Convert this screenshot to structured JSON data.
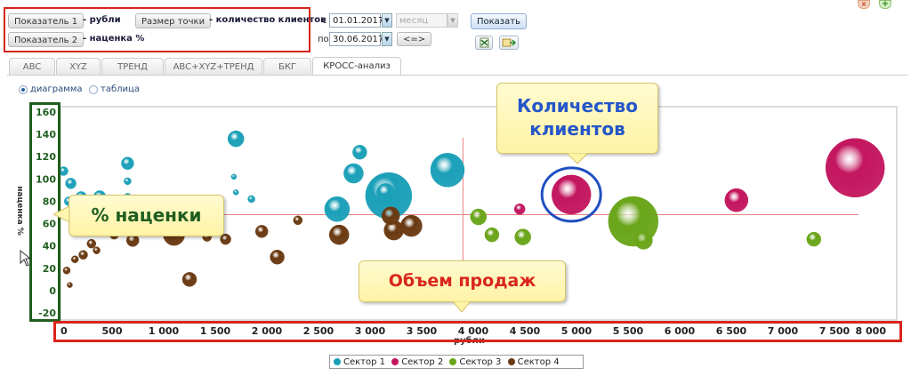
{
  "toolbar": {
    "indicator1_button": "Показатель 1",
    "indicator1_value": "- рубли",
    "indicator2_button": "Показатель 2",
    "indicator2_value": "- наценка %",
    "point_size_button": "Размер точки",
    "point_size_value": "- количество клиентов",
    "from_label": "с",
    "to_label": "по",
    "date_from": "01.01.2017",
    "date_to": "30.06.2017",
    "period_select": "месяц",
    "swap_button": "<=>",
    "show_button": "Показать"
  },
  "tabs": [
    {
      "label": "ABC"
    },
    {
      "label": "XYZ"
    },
    {
      "label": "ТРЕНД"
    },
    {
      "label": "ABC+XYZ+ТРЕНД"
    },
    {
      "label": "БКГ"
    },
    {
      "label": "КРОСС-анализ",
      "active": true
    }
  ],
  "view_mode": {
    "diagram": "диаграмма",
    "table": "таблица",
    "selected": "diagram"
  },
  "callouts": {
    "markup": "% наценки",
    "sales_volume": "Объем продаж",
    "client_count_line1": "Количество",
    "client_count_line2": "клиентов"
  },
  "colors": {
    "highlight_red": "#d9251c",
    "highlight_green": "#1f5e1f",
    "highlight_blue": "#1f4fc0",
    "callout_text_red": "#d9251c",
    "callout_text_green": "#1f5e1f",
    "callout_text_blue": "#2456c9"
  },
  "chart_data": {
    "type": "scatter",
    "subtype": "bubble",
    "xlabel": "рубли",
    "ylabel": "наценка %",
    "xlim": [
      0,
      8000
    ],
    "ylim": [
      -20,
      160
    ],
    "x_ticks": [
      "0",
      "500",
      "1 000",
      "1 500",
      "2 000",
      "2 500",
      "3 000",
      "3 500",
      "4 000",
      "4 500",
      "5 000",
      "5 500",
      "6 000",
      "6 500",
      "7 000",
      "7 500",
      "8 000"
    ],
    "y_ticks": [
      "160",
      "140",
      "120",
      "100",
      "80",
      "60",
      "40",
      "20",
      "0",
      "-20"
    ],
    "reference_lines": {
      "x": 3900,
      "y": 68
    },
    "grid": false,
    "legend_position": "bottom",
    "series": [
      {
        "name": "Сектор 1",
        "color": "#1ba0b8",
        "points": [
          {
            "x": 30,
            "y": 107,
            "size": 5
          },
          {
            "x": 100,
            "y": 96,
            "size": 6
          },
          {
            "x": 80,
            "y": 80,
            "size": 5
          },
          {
            "x": 200,
            "y": 84,
            "size": 6
          },
          {
            "x": 380,
            "y": 84,
            "size": 7
          },
          {
            "x": 650,
            "y": 114,
            "size": 7
          },
          {
            "x": 650,
            "y": 98,
            "size": 4
          },
          {
            "x": 650,
            "y": 84,
            "size": 4
          },
          {
            "x": 1700,
            "y": 136,
            "size": 9
          },
          {
            "x": 1680,
            "y": 102,
            "size": 3
          },
          {
            "x": 1850,
            "y": 82,
            "size": 4
          },
          {
            "x": 1700,
            "y": 88,
            "size": 3
          },
          {
            "x": 2680,
            "y": 73,
            "size": 14
          },
          {
            "x": 2840,
            "y": 105,
            "size": 11
          },
          {
            "x": 2900,
            "y": 124,
            "size": 8
          },
          {
            "x": 3180,
            "y": 85,
            "size": 26
          },
          {
            "x": 3150,
            "y": 88,
            "size": 10
          },
          {
            "x": 3750,
            "y": 108,
            "size": 19
          }
        ]
      },
      {
        "name": "Сектор 2",
        "color": "#c3165f",
        "points": [
          {
            "x": 4450,
            "y": 73,
            "size": 6
          },
          {
            "x": 4950,
            "y": 86,
            "size": 22
          },
          {
            "x": 6550,
            "y": 81,
            "size": 13
          },
          {
            "x": 7700,
            "y": 110,
            "size": 33
          }
        ]
      },
      {
        "name": "Сектор 3",
        "color": "#6aa51a",
        "points": [
          {
            "x": 4050,
            "y": 66,
            "size": 9
          },
          {
            "x": 4180,
            "y": 50,
            "size": 8
          },
          {
            "x": 4480,
            "y": 48,
            "size": 9
          },
          {
            "x": 5550,
            "y": 62,
            "size": 28
          },
          {
            "x": 5650,
            "y": 45,
            "size": 10
          },
          {
            "x": 7300,
            "y": 46,
            "size": 8
          }
        ]
      },
      {
        "name": "Сектор 4",
        "color": "#6a3a12",
        "points": [
          {
            "x": 60,
            "y": 18,
            "size": 4
          },
          {
            "x": 90,
            "y": 5,
            "size": 3
          },
          {
            "x": 140,
            "y": 28,
            "size": 4
          },
          {
            "x": 220,
            "y": 32,
            "size": 5
          },
          {
            "x": 300,
            "y": 42,
            "size": 5
          },
          {
            "x": 350,
            "y": 36,
            "size": 4
          },
          {
            "x": 420,
            "y": 55,
            "size": 6
          },
          {
            "x": 520,
            "y": 50,
            "size": 5
          },
          {
            "x": 700,
            "y": 45,
            "size": 7
          },
          {
            "x": 900,
            "y": 56,
            "size": 9
          },
          {
            "x": 1100,
            "y": 50,
            "size": 12
          },
          {
            "x": 1250,
            "y": 10,
            "size": 8
          },
          {
            "x": 1420,
            "y": 48,
            "size": 5
          },
          {
            "x": 1600,
            "y": 46,
            "size": 6
          },
          {
            "x": 1950,
            "y": 53,
            "size": 7
          },
          {
            "x": 2100,
            "y": 30,
            "size": 8
          },
          {
            "x": 2300,
            "y": 63,
            "size": 5
          },
          {
            "x": 2700,
            "y": 50,
            "size": 11
          },
          {
            "x": 3200,
            "y": 67,
            "size": 10
          },
          {
            "x": 3230,
            "y": 54,
            "size": 11
          },
          {
            "x": 3400,
            "y": 58,
            "size": 12
          }
        ]
      }
    ]
  }
}
